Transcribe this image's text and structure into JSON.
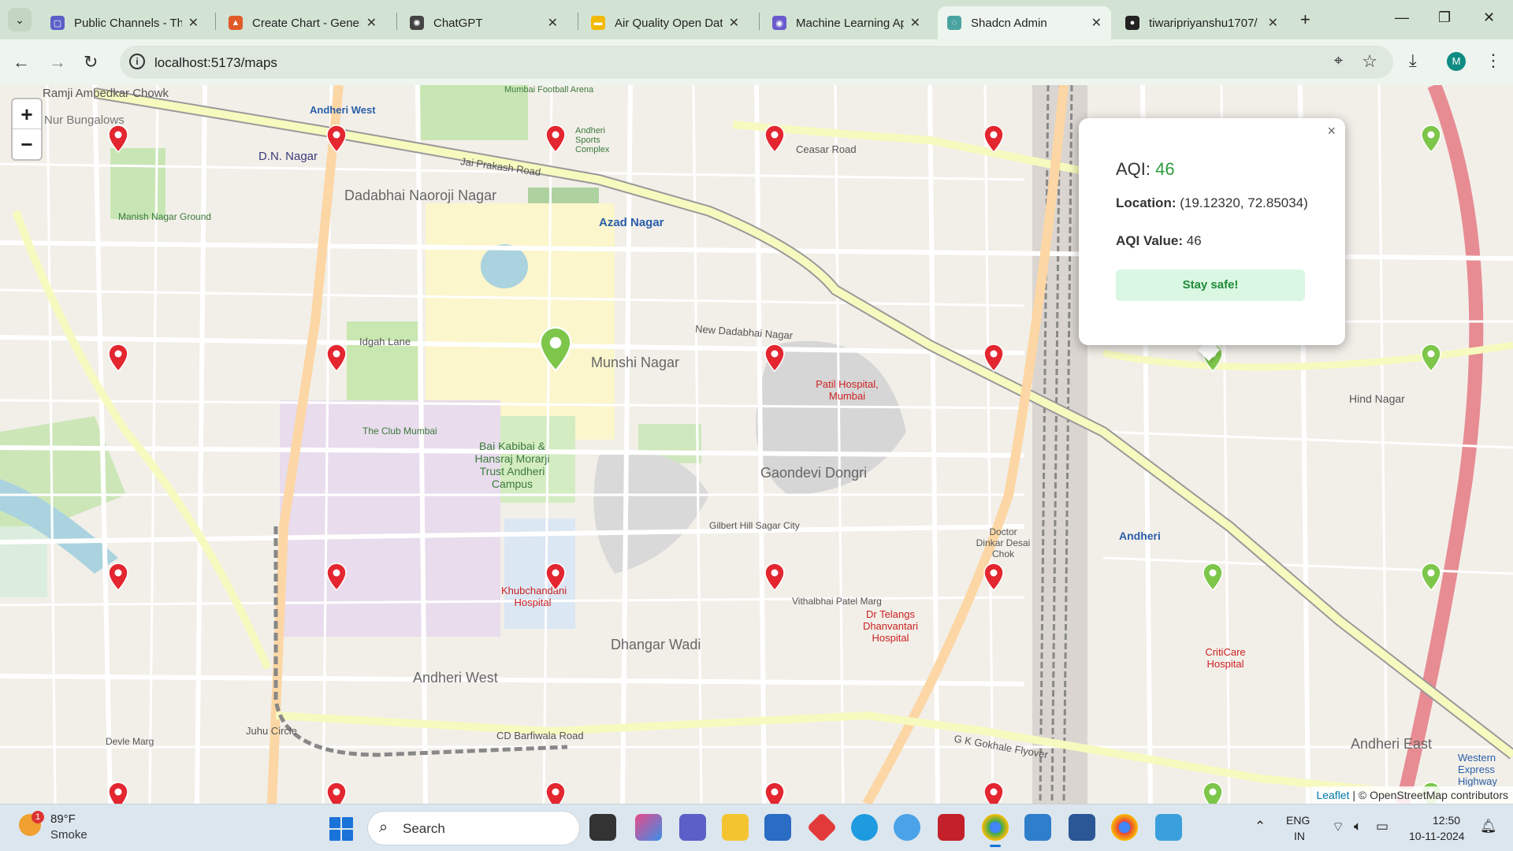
{
  "browser": {
    "tabs": [
      {
        "title": "Public Channels - Thi",
        "icon": "teams-icon",
        "color": "#5b5fc7"
      },
      {
        "title": "Create Chart - Gener",
        "icon": "chart-app-icon",
        "color": "#e05a2a"
      },
      {
        "title": "ChatGPT",
        "icon": "chatgpt-icon",
        "color": "#444444"
      },
      {
        "title": "Air Quality Open Dat",
        "icon": "air-quality-icon",
        "color": "#f2b900"
      },
      {
        "title": "Machine Learning Ap",
        "icon": "ml-app-icon",
        "color": "#6a5acd"
      },
      {
        "title": "Shadcn Admin",
        "icon": "shadcn-icon",
        "color": "#4aa3a0"
      },
      {
        "title": "tiwaripriyanshu1707/",
        "icon": "github-icon",
        "color": "#222222"
      }
    ],
    "active_tab": 5,
    "url": "localhost:5173/maps",
    "profile_initial": "M"
  },
  "map": {
    "labels": [
      "Ramji Ambedkar Chowk",
      "Nur Bungalows",
      "D.N. Nagar",
      "Dadabhai Naoroji Nagar",
      "Azad Nagar",
      "Andheri West",
      "Manish Nagar Ground",
      "Munshi Nagar",
      "Idgah Lane",
      "The Club Mumbai",
      "Bai Kabibai & Hansraj Morarji Trust Andheri Campus",
      "Gaondevi Dongri",
      "Gilbert Hill Sagar City",
      "Dhangar Wadi",
      "Andheri West",
      "Jai Prakash Road",
      "New Dadabhai Nagar",
      "Ceasar Road",
      "Hind Nagar",
      "Andheri",
      "Andheri East",
      "Doctor Dinkar Desai Chok",
      "Vithalbhai Patel Marg",
      "CD Barfiwala Road",
      "G K Gokhale Flyover",
      "Juhu Circle",
      "Devle Marg",
      "Western Express Highway",
      "Mumbai Football Arena",
      "Andheri Sports Complex"
    ],
    "poi_labels": [
      {
        "text": "Patil Hospital, Mumbai"
      },
      {
        "text": "Khubchandani Hospital"
      },
      {
        "text": "Dr Telangs Dhanvantari Hospital"
      },
      {
        "text": "CritiCare Hospital"
      }
    ],
    "zoom_in": "+",
    "zoom_out": "−",
    "attribution_leaflet": "Leaflet",
    "attribution_rest": " | © OpenStreetMap contributors"
  },
  "markers": [
    {
      "lat": 19.1232,
      "lng": 72.8503,
      "aqi": 46,
      "status": "good",
      "color": "#2e9b3c"
    }
  ],
  "popup": {
    "aqi_label": "AQI: ",
    "aqi_value": "46",
    "location_label": "Location:",
    "location_value": " (19.12320, 72.85034)",
    "aqi_value_label": "AQI Value:",
    "aqi_value_text": " 46",
    "message": "Stay safe!",
    "close": "×"
  },
  "taskbar": {
    "weather_temp": "89°F",
    "weather_desc": "Smoke",
    "weather_badge": "1",
    "search_placeholder": "Search",
    "lang_top": "ENG",
    "lang_bottom": "IN",
    "time": "12:50",
    "date": "10-11-2024"
  }
}
